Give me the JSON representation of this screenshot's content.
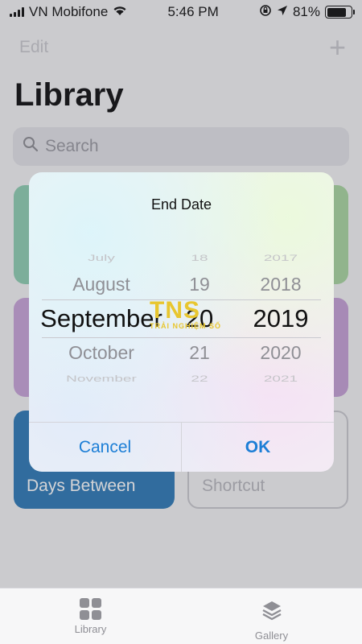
{
  "status_bar": {
    "carrier": "VN Mobifone",
    "time": "5:46 PM",
    "battery_percent": "81%",
    "battery_level": 0.81
  },
  "nav": {
    "edit_label": "Edit",
    "add_label": "+"
  },
  "page": {
    "title": "Library"
  },
  "search": {
    "placeholder": "Search"
  },
  "cards": {
    "days_between": "Days Between",
    "shortcut": "Shortcut"
  },
  "modal": {
    "title": "End Date",
    "months": [
      "July",
      "August",
      "September",
      "October",
      "November"
    ],
    "days": [
      "18",
      "19",
      "20",
      "21",
      "22"
    ],
    "years": [
      "2017",
      "2018",
      "2019",
      "2020",
      "2021"
    ],
    "cancel_label": "Cancel",
    "ok_label": "OK"
  },
  "watermark": {
    "logo": "TNS",
    "text": "TRẢI NGHIỆM SỐ"
  },
  "tab_bar": {
    "tabs": [
      {
        "label": "Library",
        "icon": "grid-icon"
      },
      {
        "label": "Gallery",
        "icon": "layers-icon"
      }
    ]
  },
  "colors": {
    "accent": "#1c7ed6",
    "days_card": "#2f7ab8"
  }
}
